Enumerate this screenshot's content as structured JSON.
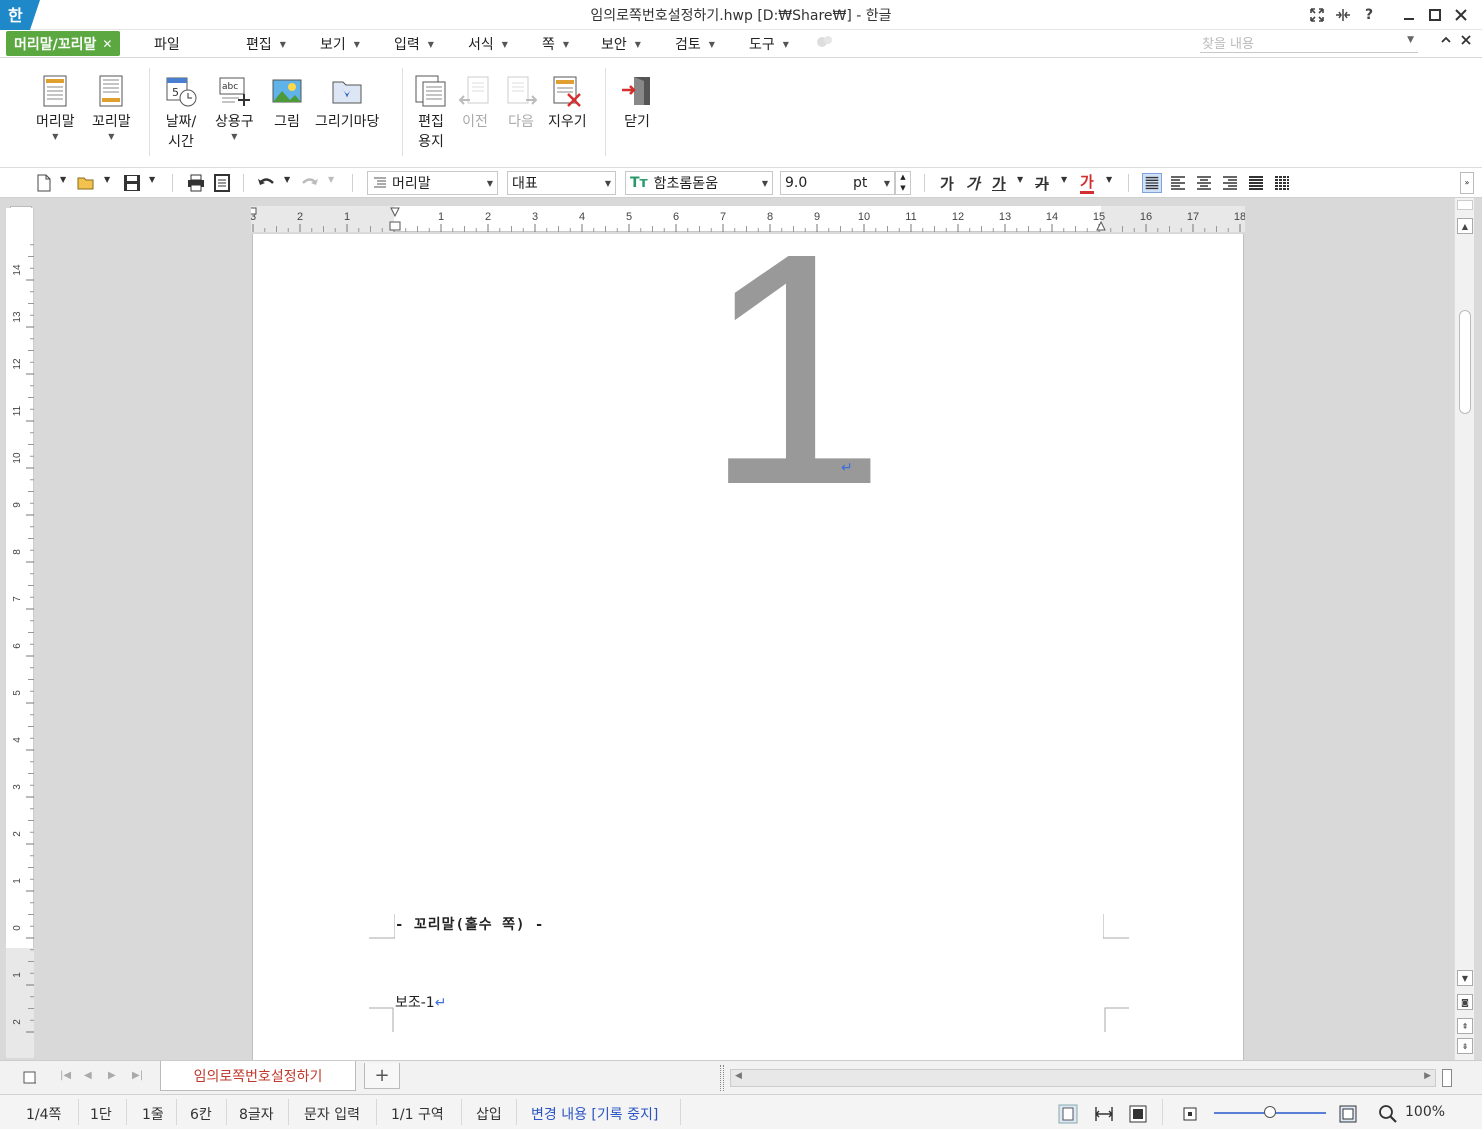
{
  "window": {
    "title": "임의로쪽번호설정하기.hwp [D:₩Share₩] - 한글",
    "app_logo": "한"
  },
  "menubar": {
    "context_tab": "머리말/꼬리말",
    "file": "파일",
    "items": [
      "편집",
      "보기",
      "입력",
      "서식",
      "쪽",
      "보안",
      "검토",
      "도구"
    ],
    "search_placeholder": "찾을 내용"
  },
  "ribbon": {
    "header": "머리말",
    "footer": "꼬리말",
    "datetime": "날짜/\n시간",
    "datetime_l1": "날짜/",
    "datetime_l2": "시간",
    "phrase": "상용구",
    "picture": "그림",
    "drawing": "그리기마당",
    "edit_paper_l1": "편집",
    "edit_paper_l2": "용지",
    "prev": "이전",
    "next": "다음",
    "delete": "지우기",
    "close": "닫기"
  },
  "format": {
    "style": "머리말",
    "lang": "대표",
    "font": "함초롬돋움",
    "size": "9.0",
    "unit": "pt",
    "bold": "가",
    "italic": "가",
    "underline": "가",
    "strike": "가",
    "color": "가",
    "accent_color": "#d32f2f"
  },
  "document": {
    "page_number": "1",
    "footer_label": "- 꼬리말(홀수 쪽) -",
    "sub_text": "보조-1",
    "return_mark": "↵"
  },
  "hruler_labels": [
    "3",
    "2",
    "1",
    "",
    "1",
    "2",
    "3",
    "4",
    "5",
    "6",
    "7",
    "8",
    "9",
    "10",
    "11",
    "12",
    "13",
    "14",
    "15",
    "16",
    "17",
    "18"
  ],
  "vruler_labels": [
    "14",
    "13",
    "12",
    "11",
    "10",
    "9",
    "8",
    "7",
    "6",
    "5",
    "4",
    "3",
    "2",
    "1",
    "0",
    "1",
    "2"
  ],
  "tabs": {
    "active_doc": "임의로쪽번호설정하기",
    "add": "+"
  },
  "status": {
    "page": "1/4쪽",
    "column": "1단",
    "line": "1줄",
    "cell": "6칸",
    "chars": "8글자",
    "mode": "문자 입력",
    "section": "1/1 구역",
    "insert": "삽입",
    "track": "변경 내용 [기록 중지]",
    "zoom": "100%",
    "track_color": "#2b55c2"
  }
}
